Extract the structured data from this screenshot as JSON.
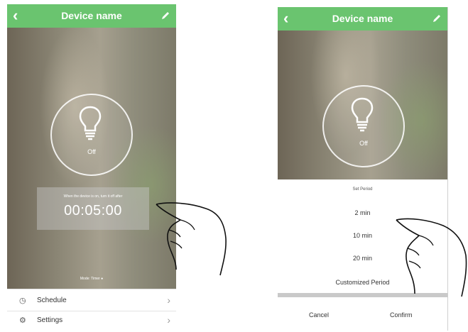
{
  "left_screen": {
    "header": {
      "back_icon": "chevron-left-icon",
      "title": "Device name",
      "edit_icon": "pencil-icon"
    },
    "bulb": {
      "icon": "light-bulb-icon",
      "state": "Off"
    },
    "timer": {
      "hint": "When the device is on, turn it off after",
      "time": "00:05:00"
    },
    "mode": "Mode: Timer",
    "menu": [
      {
        "icon": "clock-icon",
        "label": "Schedule"
      },
      {
        "icon": "gear-icon",
        "label": "Settings"
      }
    ]
  },
  "right_screen": {
    "header": {
      "back_icon": "chevron-left-icon",
      "title": "Device name",
      "edit_icon": "pencil-icon"
    },
    "bulb": {
      "icon": "light-bulb-icon",
      "state": "Off"
    },
    "sheet": {
      "title": "Set Period",
      "options": [
        "2 min",
        "10 min",
        "20 min",
        "Customized Period"
      ],
      "cancel": "Cancel",
      "confirm": "Confirm"
    }
  },
  "colors": {
    "header_green": "#6ac46f",
    "sheet_bg": "#ffffff"
  }
}
